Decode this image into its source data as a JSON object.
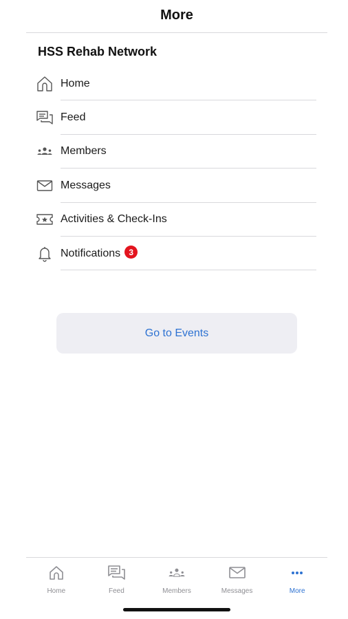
{
  "header": {
    "title": "More"
  },
  "org": {
    "name": "HSS Rehab Network"
  },
  "menu": {
    "items": [
      {
        "label": "Home",
        "icon": "home-icon"
      },
      {
        "label": "Feed",
        "icon": "feed-icon"
      },
      {
        "label": "Members",
        "icon": "members-icon"
      },
      {
        "label": "Messages",
        "icon": "messages-icon"
      },
      {
        "label": "Activities & Check-Ins",
        "icon": "ticket-icon"
      },
      {
        "label": "Notifications",
        "icon": "bell-icon",
        "badge": "3"
      }
    ]
  },
  "events_button": {
    "label": "Go to Events"
  },
  "tabbar": {
    "tabs": [
      {
        "label": "Home",
        "icon": "home-icon",
        "active": false
      },
      {
        "label": "Feed",
        "icon": "feed-icon",
        "active": false
      },
      {
        "label": "Members",
        "icon": "members-icon",
        "active": false
      },
      {
        "label": "Messages",
        "icon": "messages-icon",
        "active": false
      },
      {
        "label": "More",
        "icon": "more-icon",
        "active": true
      }
    ]
  },
  "colors": {
    "accent": "#2d72d2",
    "badge": "#e3141e",
    "inactive_tab": "#8e8e93",
    "button_bg": "#eeeef3"
  }
}
